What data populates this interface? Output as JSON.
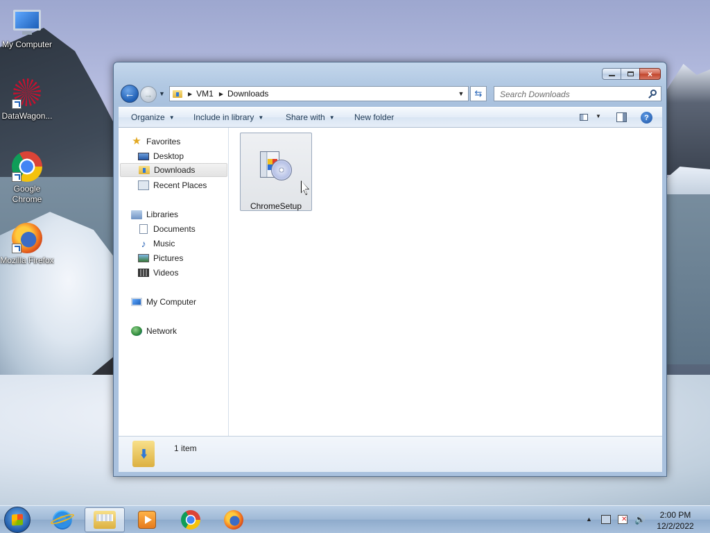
{
  "desktop": {
    "icons": [
      {
        "label": "My Computer",
        "icon": "monitor-icon"
      },
      {
        "label": "DataWagon...",
        "icon": "datawagon-icon"
      },
      {
        "label": "Google Chrome",
        "icon": "chrome-icon"
      },
      {
        "label": "Mozilla Firefox",
        "icon": "firefox-icon"
      }
    ]
  },
  "window": {
    "controls": {
      "minimize": "minimize",
      "maximize": "restore",
      "close": "×"
    },
    "address": {
      "crumbs": [
        "VM1",
        "Downloads"
      ],
      "search_placeholder": "Search Downloads"
    },
    "toolbar": {
      "organize": "Organize",
      "include_in_library": "Include in library",
      "share_with": "Share with",
      "new_folder": "New folder",
      "help": "?"
    },
    "nav_pane": {
      "favorites": {
        "label": "Favorites",
        "items": [
          "Desktop",
          "Downloads",
          "Recent Places"
        ]
      },
      "libraries": {
        "label": "Libraries",
        "items": [
          "Documents",
          "Music",
          "Pictures",
          "Videos"
        ]
      },
      "computer": "My Computer",
      "network": "Network",
      "selected": "Downloads"
    },
    "files": [
      {
        "name": "ChromeSetup",
        "icon": "installer-icon"
      }
    ],
    "details": {
      "count_text": "1 item"
    }
  },
  "taskbar": {
    "pinned": [
      "internet-explorer",
      "windows-explorer",
      "windows-media-player",
      "google-chrome",
      "mozilla-firefox"
    ],
    "active": "windows-explorer",
    "clock": {
      "time": "2:00 PM",
      "date": "12/2/2022"
    }
  },
  "colors": {
    "accent": "#1f5fb5",
    "window_frame": "#b2c9e3",
    "close_button": "#c0432a",
    "selection": "#e3e3e3"
  }
}
